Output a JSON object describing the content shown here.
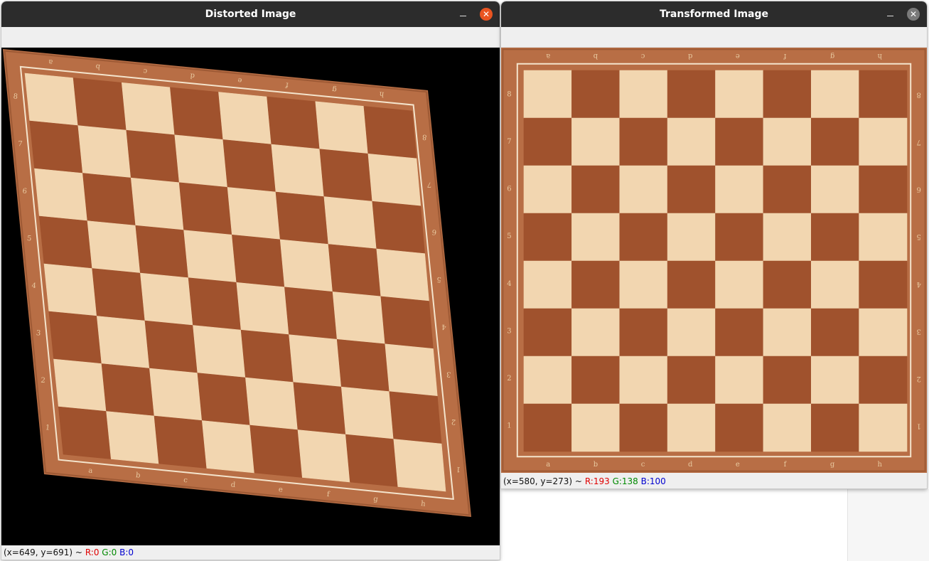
{
  "windows": {
    "left": {
      "title": "Distorted Image",
      "status": {
        "coords": "(x=649, y=691) ~",
        "r": "R:0",
        "g": "G:0",
        "b": "B:0"
      }
    },
    "right": {
      "title": "Transformed Image",
      "status": {
        "coords": "(x=580, y=273) ~",
        "r": "R:193",
        "g": "G:138",
        "b": "B:100"
      }
    }
  },
  "board": {
    "files": [
      "a",
      "b",
      "c",
      "d",
      "e",
      "f",
      "g",
      "h"
    ],
    "ranks": [
      "8",
      "7",
      "6",
      "5",
      "4",
      "3",
      "2",
      "1"
    ],
    "colors": {
      "light": "#f2d6b0",
      "dark": "#a0522d",
      "frame": "#b86e45",
      "frame_dark": "#9e5a35",
      "inlay": "#f4e4cc",
      "label": "#e8c9a0"
    }
  },
  "icons": {
    "minimize": "minimize-icon",
    "close": "close-icon"
  }
}
